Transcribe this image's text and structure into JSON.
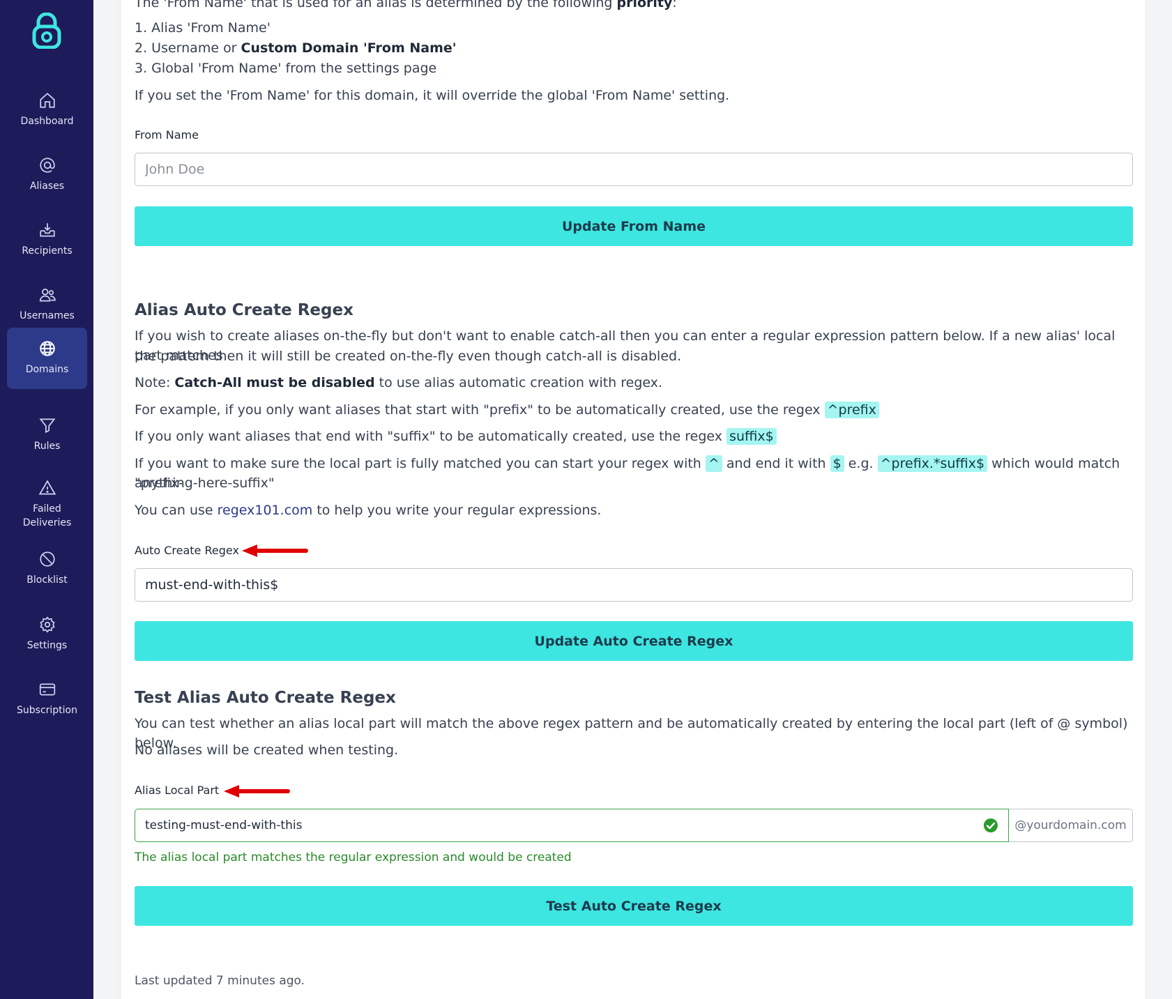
{
  "sidebar": {
    "items": [
      {
        "label": "Dashboard",
        "icon": "home-icon"
      },
      {
        "label": "Aliases",
        "icon": "at-icon"
      },
      {
        "label": "Recipients",
        "icon": "inbox-icon"
      },
      {
        "label": "Usernames",
        "icon": "users-icon"
      },
      {
        "label": "Domains",
        "icon": "globe-icon",
        "active": true
      },
      {
        "label": "Rules",
        "icon": "filter-icon"
      },
      {
        "label": "Failed Deliveries",
        "icon": "warning-icon"
      },
      {
        "label": "Blocklist",
        "icon": "block-icon"
      },
      {
        "label": "Settings",
        "icon": "gear-icon"
      },
      {
        "label": "Subscription",
        "icon": "card-icon"
      }
    ],
    "accent": "#1e1b5a",
    "active_color": "#2d3a8a"
  },
  "from_name": {
    "intro_prefix": "The 'From Name' that is used for an alias is determined by the following ",
    "intro_bold": "priority",
    "intro_suffix": ":",
    "priority_1": "1. Alias 'From Name'",
    "priority_2_prefix": "2. Username or ",
    "priority_2_bold": "Custom Domain 'From Name'",
    "priority_3": "3. Global 'From Name' from the settings page",
    "override_note": "If you set the 'From Name' for this domain, it will override the global 'From Name' setting.",
    "label": "From Name",
    "placeholder": "John Doe",
    "button": "Update From Name"
  },
  "auto_regex": {
    "heading": "Alias Auto Create Regex",
    "desc_1": "If you wish to create aliases on-the-fly but don't want to enable catch-all then you can enter a regular expression pattern below. If a new alias' local part matches",
    "desc_2": "the pattern then it will still be created on-the-fly even though catch-all is disabled.",
    "note_prefix": "Note: ",
    "note_bold": "Catch-All must be disabled",
    "note_suffix": " to use alias automatic creation with regex.",
    "example_1_prefix": "For example, if you only want aliases that start with \"prefix\" to be automatically created, use the regex ",
    "example_1_code": "^prefix",
    "example_2_prefix": "If you only want aliases that end with \"suffix\" to be automatically created, use the regex ",
    "example_2_code": "suffix$",
    "example_3_prefix": "If you want to make sure the local part is fully matched you can start your regex with ",
    "example_3_code_a": "^",
    "example_3_mid": " and end it with ",
    "example_3_code_b": "$",
    "example_3_eg": " e.g. ",
    "example_3_code_c": "^prefix.*suffix$",
    "example_3_suffix": " which would match \"prefix-",
    "example_3_line2": "anything-here-suffix\"",
    "tool_prefix": "You can use ",
    "tool_link": "regex101.com",
    "tool_suffix": " to help you write your regular expressions.",
    "label": "Auto Create Regex",
    "value": "must-end-with-this$",
    "button": "Update Auto Create Regex"
  },
  "test_regex": {
    "heading": "Test Alias Auto Create Regex",
    "desc": "You can test whether an alias local part will match the above regex pattern and be automatically created by entering the local part (left of @ symbol) below.",
    "note": "No aliases will be created when testing.",
    "label": "Alias Local Part",
    "value": "testing-must-end-with-this",
    "addon": "@yourdomain.com",
    "success": "The alias local part matches the regular expression and would be created",
    "button": "Test Auto Create Regex"
  },
  "footer": {
    "updated": "Last updated 7 minutes ago."
  },
  "colors": {
    "button": "#3de6e0",
    "success": "#2a8a2a",
    "arrow": "#e00000",
    "code_bg": "#a5f5f1"
  }
}
